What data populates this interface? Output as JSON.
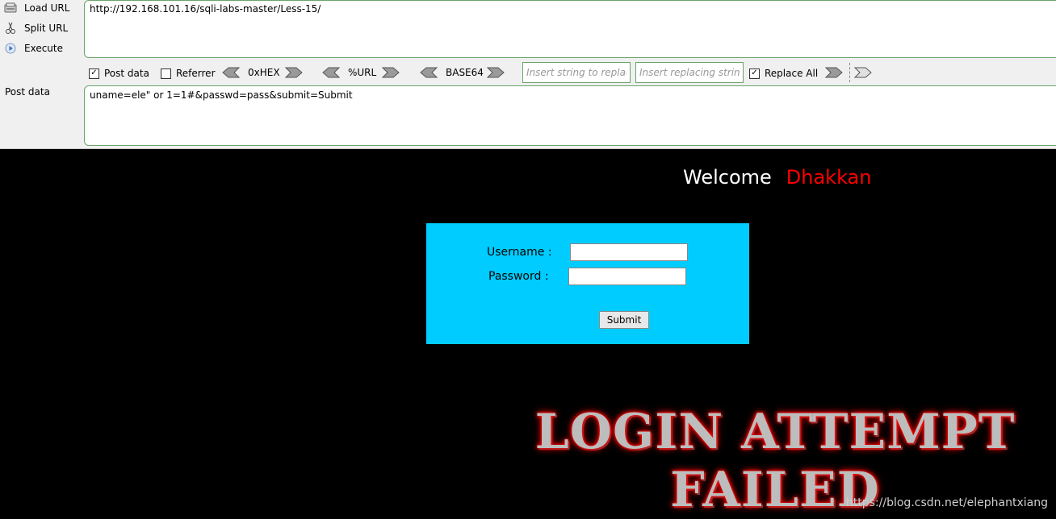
{
  "hackbar": {
    "actions": [
      {
        "label": "Load URL",
        "icon": "load-url-icon"
      },
      {
        "label": "Split URL",
        "icon": "split-url-icon"
      },
      {
        "label": "Execute",
        "icon": "execute-icon"
      }
    ],
    "url": "http://192.168.101.16/sqli-labs-master/Less-15/",
    "toolbar": {
      "post_data_label": "Post data",
      "post_data_checked": true,
      "referrer_label": "Referrer",
      "referrer_checked": false,
      "hex_label": "0xHEX",
      "url_label": "%URL",
      "base64_label": "BASE64",
      "replace_find_placeholder": "Insert string to replace",
      "replace_with_placeholder": "Insert replacing string",
      "replace_all_label": "Replace All",
      "replace_all_checked": true
    },
    "post_label": "Post data",
    "post_value": "uname=ele\" or 1=1#&passwd=pass&submit=Submit"
  },
  "page": {
    "welcome": "Welcome",
    "name": "Dhakkan",
    "form": {
      "username_label": "Username :",
      "password_label": "Password :",
      "submit_label": "Submit"
    },
    "result_line1": "LOGIN ATTEMPT",
    "result_line2": "FAILED",
    "watermark": "https://blog.csdn.net/elephantxiang"
  },
  "colors": {
    "form_bg": "#00ccff",
    "name_color": "#ff0000",
    "border_green": "#6aa56a"
  }
}
